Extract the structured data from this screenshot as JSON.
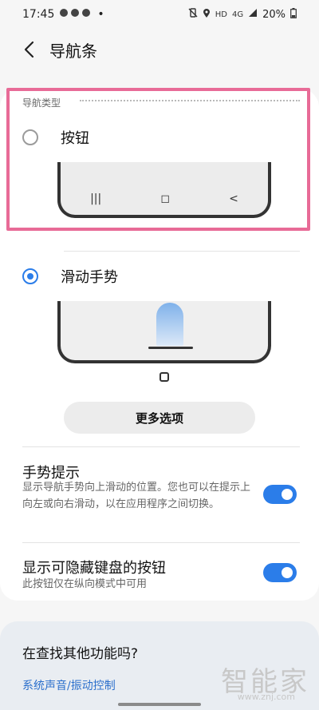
{
  "status_bar": {
    "time": "17:45",
    "left_dot": "•",
    "hd": "HD",
    "signal_label": "4G",
    "battery_percent": "20%",
    "icons": [
      "wechat-icon",
      "wechat-icon",
      "wechat-icon",
      "mute-vibrate-icon",
      "location-icon",
      "hd-icon",
      "signal-icon",
      "battery-icon"
    ]
  },
  "header": {
    "title": "导航条"
  },
  "navigation_type": {
    "section_label": "导航类型",
    "options": [
      {
        "label": "按钮",
        "selected": false,
        "nav_icons": [
          "|||",
          "◻",
          "<"
        ]
      },
      {
        "label": "滑动手势",
        "selected": true
      }
    ]
  },
  "more_options_label": "更多选项",
  "settings": [
    {
      "title": "手势提示",
      "description": "显示导航手势向上滑动的位置。您也可以在提示上向左或向右滑动，以在应用程序之间切换。",
      "enabled": true
    },
    {
      "title": "显示可隐藏键盘的按钮",
      "description": "此按钮仅在纵向模式中可用",
      "enabled": true
    }
  ],
  "find_more": {
    "title": "在查找其他功能吗?",
    "link": "系统声音/振动控制"
  },
  "watermark": {
    "text": "智能家",
    "url": "www.znj.com"
  },
  "colors": {
    "accent": "#2b7de9",
    "highlight": "#e86b97",
    "background": "#f6f6f6",
    "card": "#ffffff"
  }
}
